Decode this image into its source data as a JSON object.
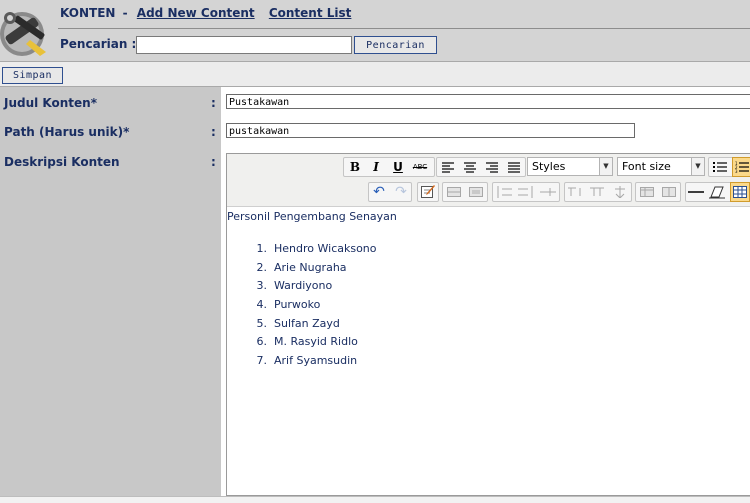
{
  "header": {
    "section": "KONTEN",
    "separator": "-",
    "add_link": "Add New Content",
    "list_link": "Content List",
    "search_label": "Pencarian :",
    "search_value": "",
    "search_button": "Pencarian"
  },
  "toolbar": {
    "save_label": "Simpan"
  },
  "form": {
    "title_label": "Judul Konten*",
    "title_value": "Pustakawan",
    "path_label": "Path (Harus unik)*",
    "path_value": "pustakawan",
    "desc_label": "Deskripsi Konten",
    "colon": ":"
  },
  "editor": {
    "styles_dropdown": "Styles",
    "fontsize_dropdown": "Font size",
    "buttons": {
      "bold": "B",
      "italic": "I",
      "underline": "U",
      "strike": "ABC"
    },
    "content": {
      "heading": "Personil Pengembang Senayan",
      "items": [
        {
          "num": "1.",
          "text": "Hendro Wicaksono"
        },
        {
          "num": "2.",
          "text": "Arie Nugraha"
        },
        {
          "num": "3.",
          "text": "Wardiyono"
        },
        {
          "num": "4.",
          "text": "Purwoko"
        },
        {
          "num": "5.",
          "text": "Sulfan Zayd"
        },
        {
          "num": "6.",
          "text": "M. Rasyid Ridlo"
        },
        {
          "num": "7.",
          "text": "Arif Syamsudin"
        }
      ]
    }
  },
  "colors": {
    "link": "#1a2e62",
    "header_bg": "#d4d4d4",
    "sidebar_bg": "#c8c8c8"
  }
}
